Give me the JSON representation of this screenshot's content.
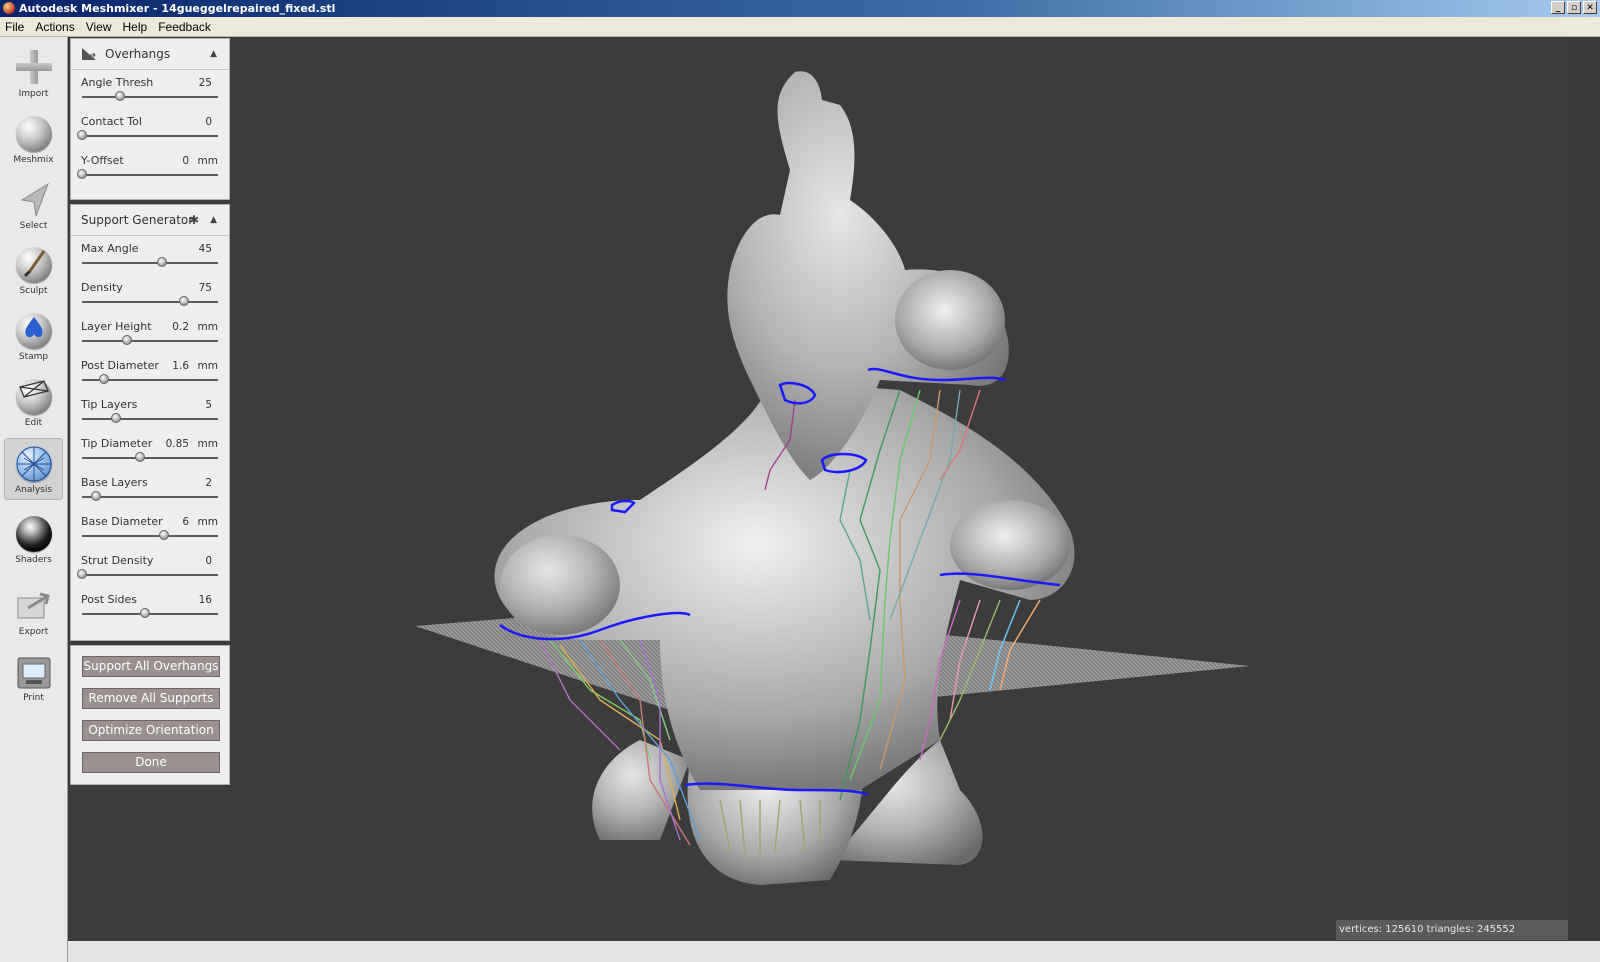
{
  "window": {
    "title": "Autodesk Meshmixer - 14gueggelrepaired_fixed.stl",
    "buttons": [
      "_",
      "▫",
      "✕"
    ]
  },
  "menu": [
    "File",
    "Actions",
    "View",
    "Help",
    "Feedback"
  ],
  "toolbar": [
    {
      "label": "Import",
      "icon": "plus-icon"
    },
    {
      "label": "Meshmix",
      "icon": "meshmix-sphere-icon"
    },
    {
      "label": "Select",
      "icon": "select-arrow-icon"
    },
    {
      "label": "Sculpt",
      "icon": "sculpt-brush-icon"
    },
    {
      "label": "Stamp",
      "icon": "stamp-icon"
    },
    {
      "label": "Edit",
      "icon": "edit-wireframe-icon"
    },
    {
      "label": "Analysis",
      "icon": "analysis-icon",
      "active": true
    },
    {
      "label": "Shaders",
      "icon": "shader-sphere-icon"
    },
    {
      "label": "Export",
      "icon": "export-icon"
    },
    {
      "label": "Print",
      "icon": "printer-icon"
    }
  ],
  "overhangs": {
    "title": "Overhangs",
    "params": [
      {
        "label": "Angle Thresh",
        "value": "25",
        "unit": "",
        "fraction": 0.28
      },
      {
        "label": "Contact Tol",
        "value": "0",
        "unit": "",
        "fraction": 0.0
      },
      {
        "label": "Y-Offset",
        "value": "0",
        "unit": "mm",
        "fraction": 0.0
      }
    ]
  },
  "support": {
    "title": "Support Generator",
    "params": [
      {
        "label": "Max Angle",
        "value": "45",
        "unit": "",
        "fraction": 0.59
      },
      {
        "label": "Density",
        "value": "75",
        "unit": "",
        "fraction": 0.75
      },
      {
        "label": "Layer Height",
        "value": "0.2",
        "unit": "mm",
        "fraction": 0.33
      },
      {
        "label": "Post Diameter",
        "value": "1.6",
        "unit": "mm",
        "fraction": 0.16
      },
      {
        "label": "Tip Layers",
        "value": "5",
        "unit": "",
        "fraction": 0.25
      },
      {
        "label": "Tip Diameter",
        "value": "0.85",
        "unit": "mm",
        "fraction": 0.43
      },
      {
        "label": "Base Layers",
        "value": "2",
        "unit": "",
        "fraction": 0.1
      },
      {
        "label": "Base Diameter",
        "value": "6",
        "unit": "mm",
        "fraction": 0.6
      },
      {
        "label": "Strut Density",
        "value": "0",
        "unit": "",
        "fraction": 0.0
      },
      {
        "label": "Post Sides",
        "value": "16",
        "unit": "",
        "fraction": 0.46
      }
    ]
  },
  "actions": [
    "Support All Overhangs",
    "Remove All Supports",
    "Optimize Orientation",
    "Done"
  ],
  "status": "vertices: 125610 triangles: 245552",
  "colors": {
    "overhang_outline": "#1a1aff",
    "mesh": "#b8b8b8",
    "background": "#3c3c3c"
  }
}
